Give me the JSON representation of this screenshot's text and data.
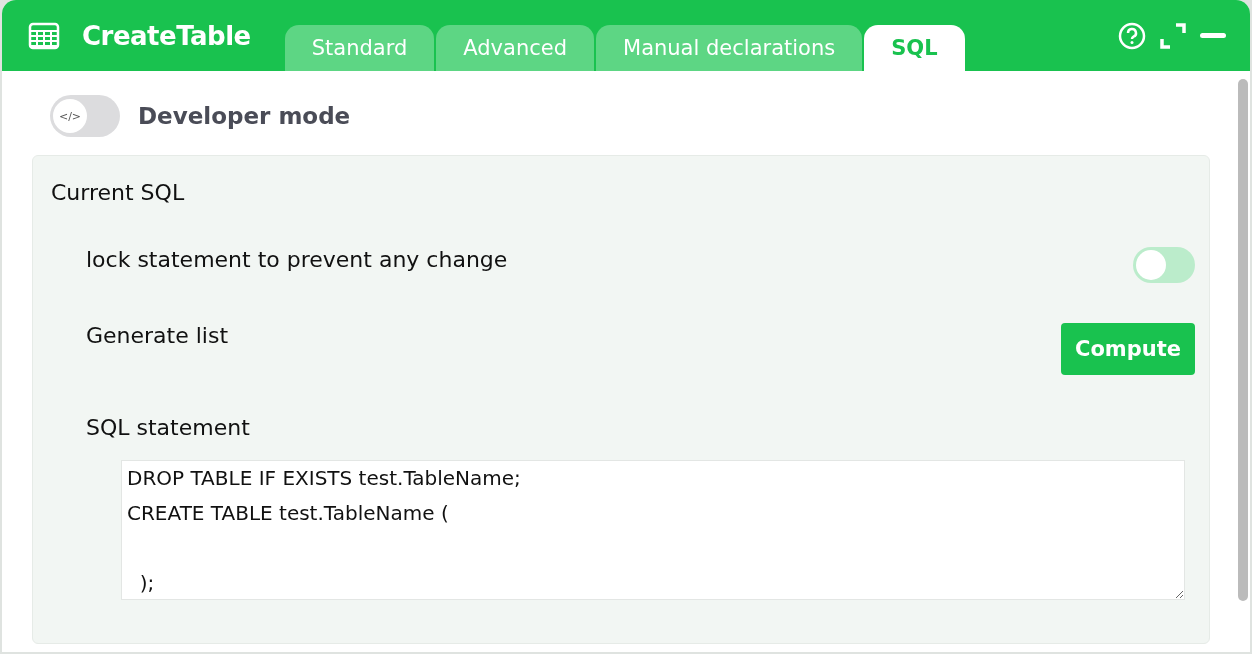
{
  "window": {
    "title": "CreateTable"
  },
  "tabs": [
    {
      "label": "Standard",
      "selected": false
    },
    {
      "label": "Advanced",
      "selected": false
    },
    {
      "label": "Manual declarations",
      "selected": false
    },
    {
      "label": "SQL",
      "selected": true
    }
  ],
  "developer_mode": {
    "label": "Developer mode",
    "knob_label": "</>",
    "on": false
  },
  "panel": {
    "title": "Current SQL",
    "lock": {
      "label": "lock statement to prevent any change",
      "on": false
    },
    "generate": {
      "label": "Generate list",
      "button": "Compute"
    },
    "statement": {
      "label": "SQL statement",
      "value": "DROP TABLE IF EXISTS test.TableName;\nCREATE TABLE test.TableName (\n\n  );"
    }
  }
}
